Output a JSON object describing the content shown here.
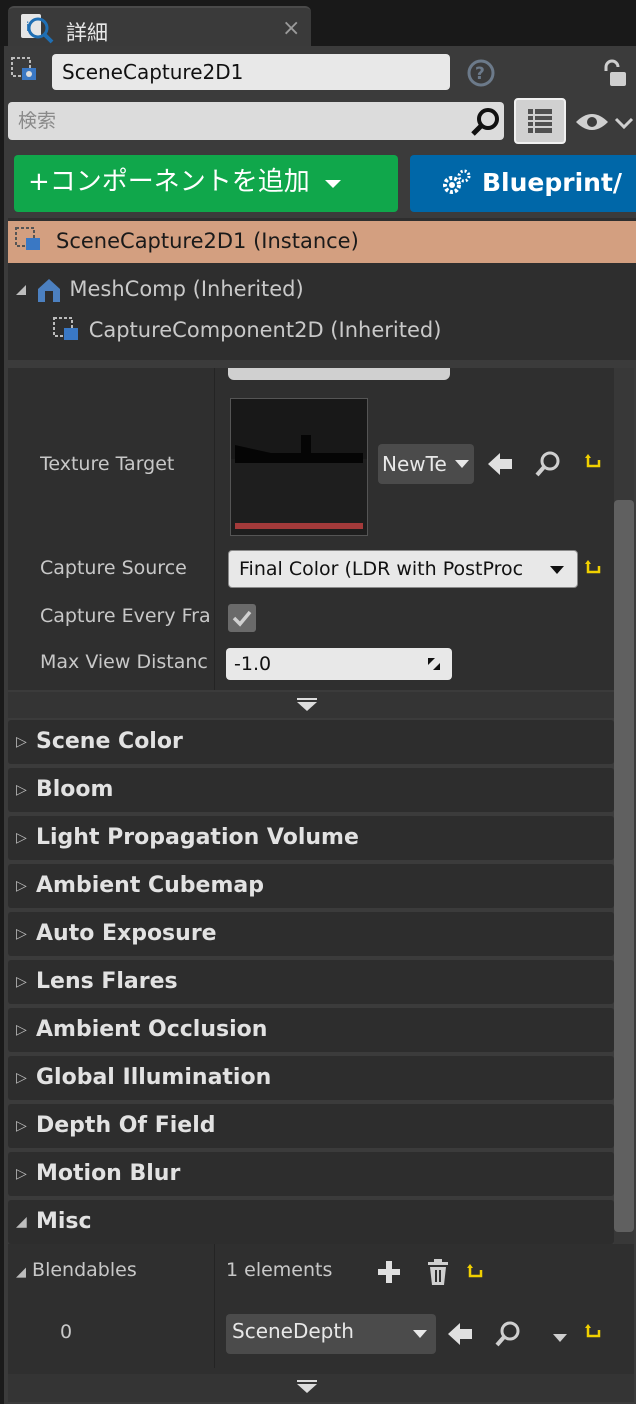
{
  "tab": {
    "title": "詳細",
    "close": "×"
  },
  "header": {
    "object_name": "SceneCapture2D1",
    "help": "?"
  },
  "search": {
    "placeholder": "検索"
  },
  "buttons": {
    "add_component": "+コンポーネントを追加",
    "blueprint": "Blueprint/"
  },
  "tree": {
    "instance": "SceneCapture2D1 (Instance)",
    "items": [
      {
        "label": "MeshComp (Inherited)"
      },
      {
        "label": "CaptureComponent2D (Inherited)"
      }
    ]
  },
  "properties": {
    "texture_target": {
      "label": "Texture Target",
      "value": "NewTe"
    },
    "capture_source": {
      "label": "Capture Source",
      "value": "Final Color (LDR with PostProc"
    },
    "capture_every_frame": {
      "label": "Capture Every Fra",
      "checked": true
    },
    "max_view_distance": {
      "label": "Max View Distanc",
      "value": "-1.0"
    }
  },
  "categories": [
    "Scene Color",
    "Bloom",
    "Light Propagation Volume",
    "Ambient Cubemap",
    "Auto Exposure",
    "Lens Flares",
    "Ambient Occlusion",
    "Global Illumination",
    "Depth Of Field",
    "Motion Blur"
  ],
  "misc": {
    "title": "Misc",
    "blendables": {
      "label": "Blendables",
      "count": "1 elements"
    },
    "element": {
      "index": "0",
      "value": "SceneDepth"
    }
  },
  "colors": {
    "add_button": "#10a74b",
    "blueprint_button": "#0067a8",
    "instance_row": "#d39f80",
    "reset_arrow": "#f0d000"
  },
  "icons": [
    "search-icon",
    "list-view-icon",
    "eye-icon",
    "lock-icon",
    "help-icon",
    "gear-icon",
    "back-arrow-icon",
    "magnifier-icon",
    "reset-icon",
    "plus-icon",
    "trash-icon",
    "chevron-down-icon",
    "expand-icon"
  ]
}
